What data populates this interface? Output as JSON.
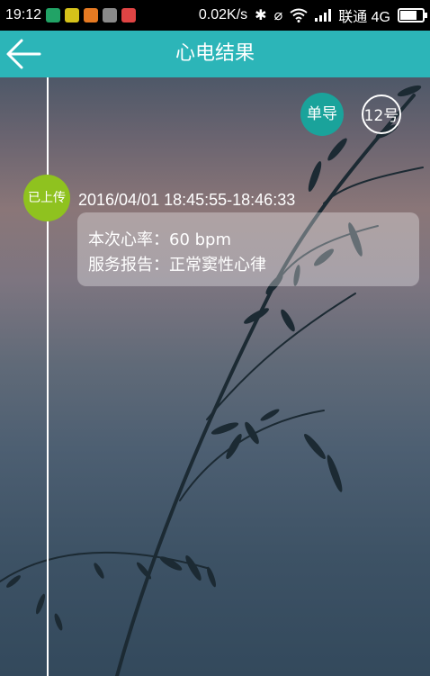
{
  "status_bar": {
    "time": "19:12",
    "net_speed": "0.02K/s",
    "carrier": "联通 4G",
    "app_icon_colors": [
      "#21a366",
      "#d5c21a",
      "#e67a22",
      "#8a8a8a",
      "#e04444"
    ]
  },
  "header": {
    "title": "心电结果",
    "back_icon": "arrow-left-icon",
    "bar_color": "#2cb5b8"
  },
  "lead_buttons": {
    "single": "单导",
    "twelve": "12号"
  },
  "record": {
    "status_badge": "已上传",
    "datetime": "2016/04/01  18:45:55-18:46:33",
    "heart_rate_label": "本次心率：",
    "heart_rate_value": "60 bpm",
    "report_label": "服务报告：",
    "report_value": "正常窦性心律"
  },
  "colors": {
    "badge_green": "#8fc21f",
    "single_lead_teal": "#1aa39b"
  }
}
